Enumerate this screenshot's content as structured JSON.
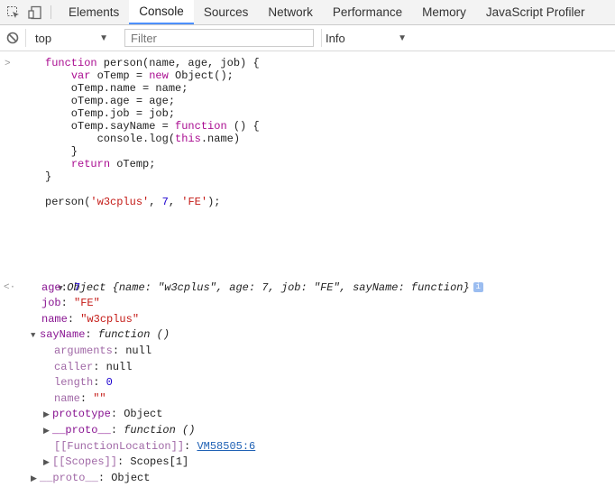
{
  "tabs": [
    "Elements",
    "Console",
    "Sources",
    "Network",
    "Performance",
    "Memory",
    "JavaScript Profiler"
  ],
  "active_tab": "Console",
  "toolbar": {
    "context": "top",
    "filter_placeholder": "Filter",
    "level": "Info"
  },
  "code_lines": [
    "function person(name, age, job) {",
    "    var oTemp = new Object();",
    "    oTemp.name = name;",
    "    oTemp.age = age;",
    "    oTemp.job = job;",
    "    oTemp.sayName = function () {",
    "        console.log(this.name)",
    "    }",
    "    return oTemp;",
    "}",
    "",
    "person('w3cplus', 7, 'FE');"
  ],
  "result": {
    "summary_name": "Object",
    "summary_props": "{name: \"w3cplus\", age: 7, job: \"FE\", sayName: function}",
    "props": [
      {
        "key": "age",
        "value": "7"
      },
      {
        "key": "job",
        "value": "\"FE\""
      },
      {
        "key": "name",
        "value": "\"w3cplus\""
      }
    ],
    "sayName_label": "sayName",
    "sayName_value": "function ()",
    "fn_props": [
      {
        "key": "arguments",
        "value": "null"
      },
      {
        "key": "caller",
        "value": "null"
      },
      {
        "key": "length",
        "value": "0"
      },
      {
        "key": "name",
        "value": "\"\""
      }
    ],
    "prototype_key": "prototype",
    "prototype_value": "Object",
    "fn_proto_key": "__proto__",
    "fn_proto_value": "function ()",
    "location_key": "[[FunctionLocation]]",
    "location_value": "VM58505:6",
    "scopes_key": "[[Scopes]]",
    "scopes_value": "Scopes[1]",
    "proto_key": "__proto__",
    "proto_value": "Object"
  }
}
